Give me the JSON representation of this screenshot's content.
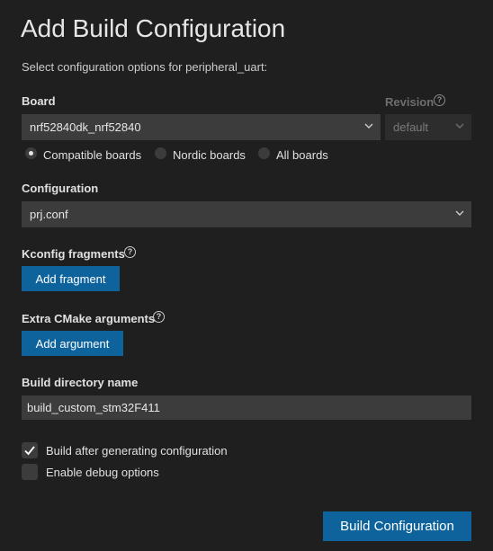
{
  "header": {
    "title": "Add Build Configuration",
    "subtitle": "Select configuration options for peripheral_uart:"
  },
  "board": {
    "label": "Board",
    "value": "nrf52840dk_nrf52840",
    "revision_label": "Revision",
    "revision_value": "default",
    "radios": [
      {
        "label": "Compatible boards",
        "checked": true
      },
      {
        "label": "Nordic boards",
        "checked": false
      },
      {
        "label": "All boards",
        "checked": false
      }
    ]
  },
  "configuration": {
    "label": "Configuration",
    "value": "prj.conf"
  },
  "kconfig": {
    "label": "Kconfig fragments",
    "button_label": "Add fragment"
  },
  "cmake": {
    "label": "Extra CMake arguments",
    "button_label": "Add argument"
  },
  "build_dir": {
    "label": "Build directory name",
    "value": "build_custom_stm32F411"
  },
  "options": [
    {
      "label": "Build after generating configuration",
      "checked": true
    },
    {
      "label": "Enable debug options",
      "checked": false
    }
  ],
  "footer": {
    "submit_label": "Build Configuration"
  },
  "colors": {
    "background": "#1f1f1f",
    "input_bg": "#3c3c3c",
    "button": "#0e639c"
  },
  "icons": {
    "help": "help-circle-icon",
    "dropdown": "chevron-down-icon",
    "check": "check-icon"
  }
}
